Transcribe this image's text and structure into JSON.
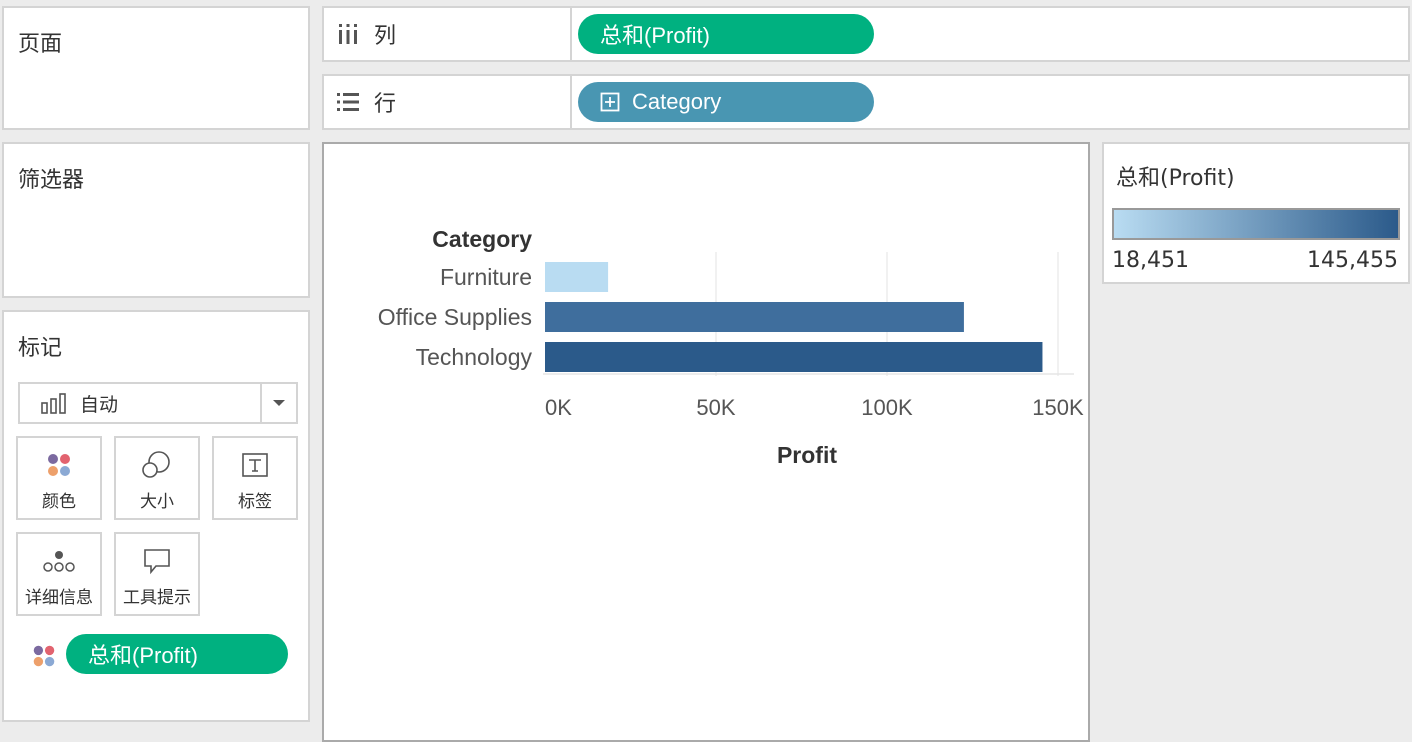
{
  "pages_card": {
    "title": "页面"
  },
  "filters_card": {
    "title": "筛选器"
  },
  "marks_card": {
    "title": "标记",
    "mark_type": "自动",
    "buttons": [
      {
        "label": "颜色",
        "icon": "color-dots-icon"
      },
      {
        "label": "大小",
        "icon": "size-circles-icon"
      },
      {
        "label": "标签",
        "icon": "label-t-icon"
      },
      {
        "label": "详细信息",
        "icon": "detail-dots-icon"
      },
      {
        "label": "工具提示",
        "icon": "tooltip-bubble-icon"
      }
    ],
    "color_pill": "总和(Profit)"
  },
  "columns_shelf": {
    "label": "列",
    "pill": "总和(Profit)"
  },
  "rows_shelf": {
    "label": "行",
    "pill": "Category"
  },
  "legend": {
    "title": "总和(Profit)",
    "min_label": "18,451",
    "max_label": "145,455",
    "color_low": "#b9dcf2",
    "color_high": "#2b5a8a"
  },
  "colors": {
    "green_pill": "#00b180",
    "blue_pill": "#4996b2"
  },
  "chart_data": {
    "type": "bar",
    "orientation": "horizontal",
    "row_header": "Category",
    "categories": [
      "Furniture",
      "Office Supplies",
      "Technology"
    ],
    "values": [
      18451,
      122491,
      145455
    ],
    "colors": [
      "#b9dcf2",
      "#3f6e9d",
      "#2b5a8a"
    ],
    "xlabel": "Profit",
    "xlim": [
      0,
      150000
    ],
    "xticks": [
      0,
      50000,
      100000,
      150000
    ],
    "xtick_labels": [
      "0K",
      "50K",
      "100K",
      "150K"
    ],
    "grid": true
  }
}
